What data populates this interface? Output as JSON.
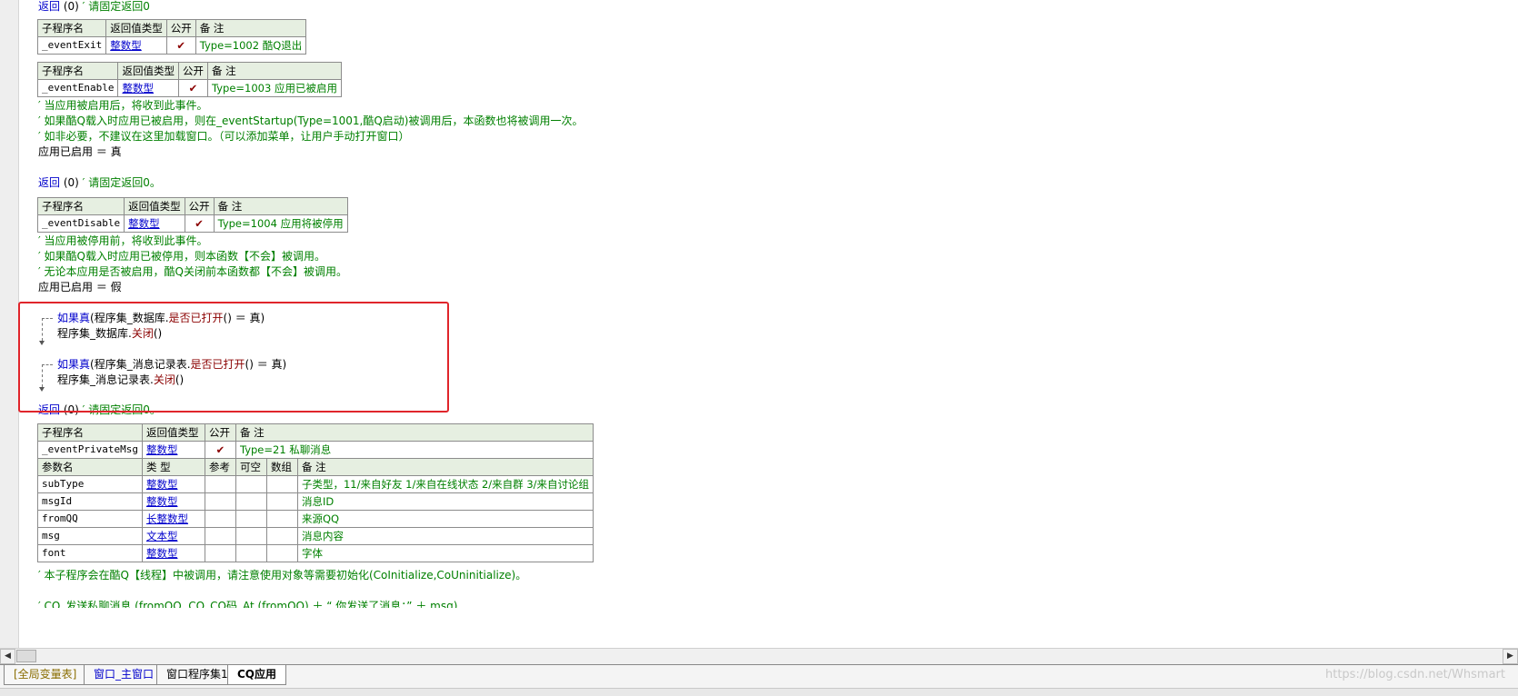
{
  "line_return_top": {
    "kw": "返回",
    "args": "(0)",
    "comment": "′ 请固定返回0"
  },
  "t_exit": {
    "headers": [
      "子程序名",
      "返回值类型",
      "公开",
      "备 注"
    ],
    "name": "_eventExit",
    "type": "整数型",
    "public": "✔",
    "remark": "Type=1002 酷Q退出"
  },
  "t_enable": {
    "headers": [
      "子程序名",
      "返回值类型",
      "公开",
      "备 注"
    ],
    "name": "_eventEnable",
    "type": "整数型",
    "public": "✔",
    "remark": "Type=1003 应用已被启用"
  },
  "enable_comments": [
    "′ 当应用被启用后，将收到此事件。",
    "′ 如果酷Q载入时应用已被启用，则在_eventStartup(Type=1001,酷Q启动)被调用后，本函数也将被调用一次。",
    "′ 如非必要，不建议在这里加载窗口。（可以添加菜单，让用户手动打开窗口）"
  ],
  "enable_assign": "应用已启用 ＝ 真",
  "line_return_2": {
    "kw": "返回",
    "args": "(0)",
    "comment": "′ 请固定返回0。"
  },
  "t_disable": {
    "headers": [
      "子程序名",
      "返回值类型",
      "公开",
      "备 注"
    ],
    "name": "_eventDisable",
    "type": "整数型",
    "public": "✔",
    "remark": "Type=1004 应用将被停用"
  },
  "disable_comments": [
    "′ 当应用被停用前，将收到此事件。",
    "′ 如果酷Q载入时应用已被停用，则本函数【不会】被调用。",
    "′ 无论本应用是否被启用，酷Q关闭前本函数都【不会】被调用。"
  ],
  "disable_assign": "应用已启用 ＝ 假",
  "if1": {
    "kw": "如果真",
    "pre": "(程序集_数据库.",
    "method": "是否已打开",
    "post": "() ＝ 真)"
  },
  "close1": {
    "obj": "程序集_数据库.",
    "method": "关闭",
    "args": "()"
  },
  "if2": {
    "kw": "如果真",
    "pre": "(程序集_消息记录表.",
    "method": "是否已打开",
    "post": "() ＝ 真)"
  },
  "close2": {
    "obj": "程序集_消息记录表.",
    "method": "关闭",
    "args": "()"
  },
  "line_return_3": {
    "kw": "返回",
    "args": "(0)",
    "comment": "′ 请固定返回0。"
  },
  "t_private": {
    "headers": [
      "子程序名",
      "返回值类型",
      "公开",
      "备 注"
    ],
    "name": "_eventPrivateMsg",
    "type": "整数型",
    "public": "✔",
    "remark": "Type=21 私聊消息",
    "param_headers": [
      "参数名",
      "类 型",
      "参考",
      "可空",
      "数组",
      "备 注"
    ],
    "params": [
      {
        "name": "subType",
        "type": "整数型",
        "remark": "子类型，11/来自好友 1/来自在线状态 2/来自群 3/来自讨论组"
      },
      {
        "name": "msgId",
        "type": "整数型",
        "remark": "消息ID"
      },
      {
        "name": "fromQQ",
        "type": "长整数型",
        "remark": "来源QQ"
      },
      {
        "name": "msg",
        "type": "文本型",
        "remark": "消息内容"
      },
      {
        "name": "font",
        "type": "整数型",
        "remark": "字体"
      }
    ]
  },
  "private_comment": "′ 本子程序会在酷Q【线程】中被调用，请注意使用对象等需要初始化(CoInitialize,CoUninitialize)。",
  "cut_line": "′ CQ_发送私聊消息 (fromQQ, CQ_CQ码_At (fromQQ) ＋ “ 你发送了消息：” ＋ msg)",
  "tabs": [
    "[全局变量表]",
    "窗口_主窗口",
    "窗口程序集1",
    "CQ应用"
  ],
  "watermark": "https://blog.csdn.net/Whsmart",
  "scroll": {
    "left": "◀",
    "right": "▶"
  }
}
